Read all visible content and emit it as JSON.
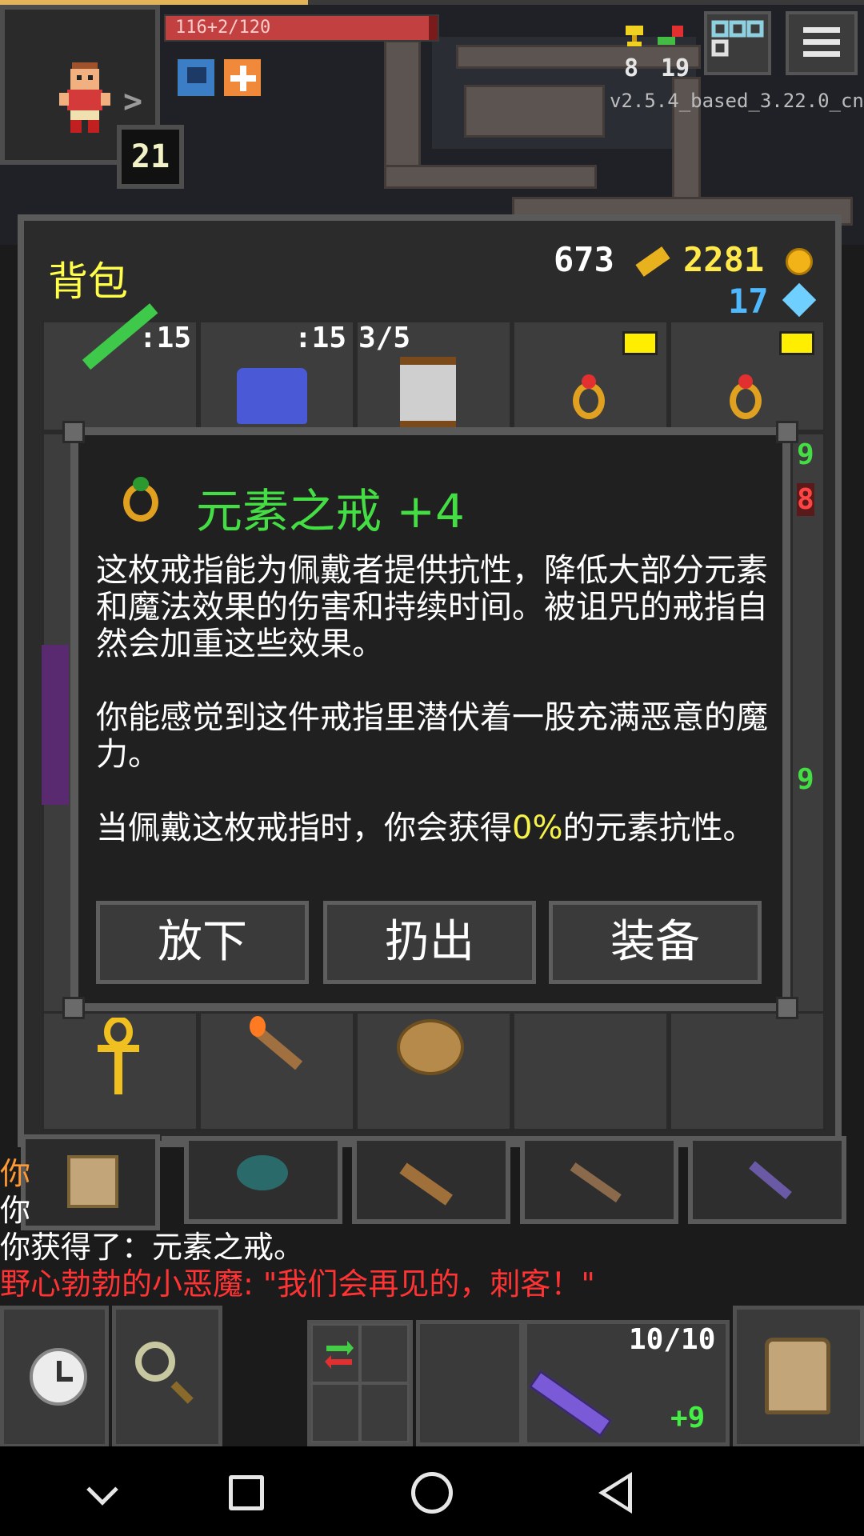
{
  "status": {
    "hp_text": "116+2/120",
    "hp_fraction": 0.967,
    "level": "21",
    "challenges": "8",
    "depth": "19",
    "version": "v2.5.4_based_3.22.0_cn"
  },
  "backpack": {
    "title": "背包",
    "gold": "673",
    "energy": "2281",
    "gems": "17",
    "top_slots": [
      {
        "count": ":15"
      },
      {
        "count": ":15"
      },
      {
        "count": "3/5"
      }
    ],
    "side_tags": [
      "9",
      "8",
      "9"
    ]
  },
  "item_dialog": {
    "title": "元素之戒 +4",
    "paragraph1": "这枚戒指能为佩戴者提供抗性，降低大部分元素和魔法效果的伤害和持续时间。被诅咒的戒指自然会加重这些效果。",
    "paragraph2": "你能感觉到这件戒指里潜伏着一股充满恶意的魔力。",
    "paragraph3_prefix": "当佩戴这枚戒指时，你会获得",
    "paragraph3_value": "0%",
    "paragraph3_suffix": "的元素抗性。",
    "buttons": {
      "drop": "放下",
      "throw": "扔出",
      "equip": "装备"
    }
  },
  "log": {
    "line1": "你",
    "line2": "你",
    "line3": "你获得了：元素之戒。",
    "line4": "野心勃勃的小恶魔: \"我们会再见的，刺客！\""
  },
  "toolbar": {
    "wand_charges": "10/10",
    "wand_bonus": "+9"
  },
  "colors": {
    "title_yellow": "#ffff4a",
    "item_name_green": "#44dd44",
    "highlight_yellow": "#f6f24a",
    "log_red": "#ff3333"
  }
}
